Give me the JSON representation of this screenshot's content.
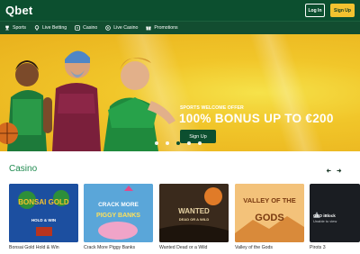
{
  "header": {
    "logo": "Qbet",
    "login_label": "Log In",
    "signup_label": "Sign Up",
    "colors": {
      "primary": "#0c4f2f",
      "accent": "#f2c230"
    }
  },
  "nav": {
    "items": [
      {
        "icon": "trophy-icon",
        "label": "Sports"
      },
      {
        "icon": "live-betting-icon",
        "label": "Live Betting"
      },
      {
        "icon": "casino-icon",
        "label": "Casino"
      },
      {
        "icon": "live-casino-icon",
        "label": "Live Casino"
      },
      {
        "icon": "gift-icon",
        "label": "Promotions"
      }
    ]
  },
  "hero": {
    "subtitle": "SPORTS WELCOME OFFER",
    "title": "100% BONUS UP TO €200",
    "cta_label": "Sign Up",
    "slides": 5,
    "active_slide": 3
  },
  "casino": {
    "title": "Casino",
    "prev_icon": "arrow-left-icon",
    "next_icon": "arrow-right-icon",
    "games": [
      {
        "label": "Bonsai Gold Hold & Win",
        "art_text": "BONSAI GOLD",
        "art_sub": "HOLD & WIN",
        "bg": "#1c4fa0"
      },
      {
        "label": "Crack More Piggy Banks",
        "art_text": "CRACK MORE",
        "art_sub": "PIGGY BANKS",
        "bg": "#5aa6d9"
      },
      {
        "label": "Wanted Dead or a Wild",
        "art_text": "WANTED",
        "art_sub": "DEAD OR A WILD",
        "bg": "#3a2a1c"
      },
      {
        "label": "Valley of the Gods",
        "art_text": "VALLEY OF THE",
        "art_sub": "GODS",
        "bg": "#f0a84c"
      },
      {
        "label": "Pirots 3",
        "art_text": "GEO iBlock",
        "art_sub": "Unable to view",
        "bg": "#1a1d22"
      }
    ]
  }
}
